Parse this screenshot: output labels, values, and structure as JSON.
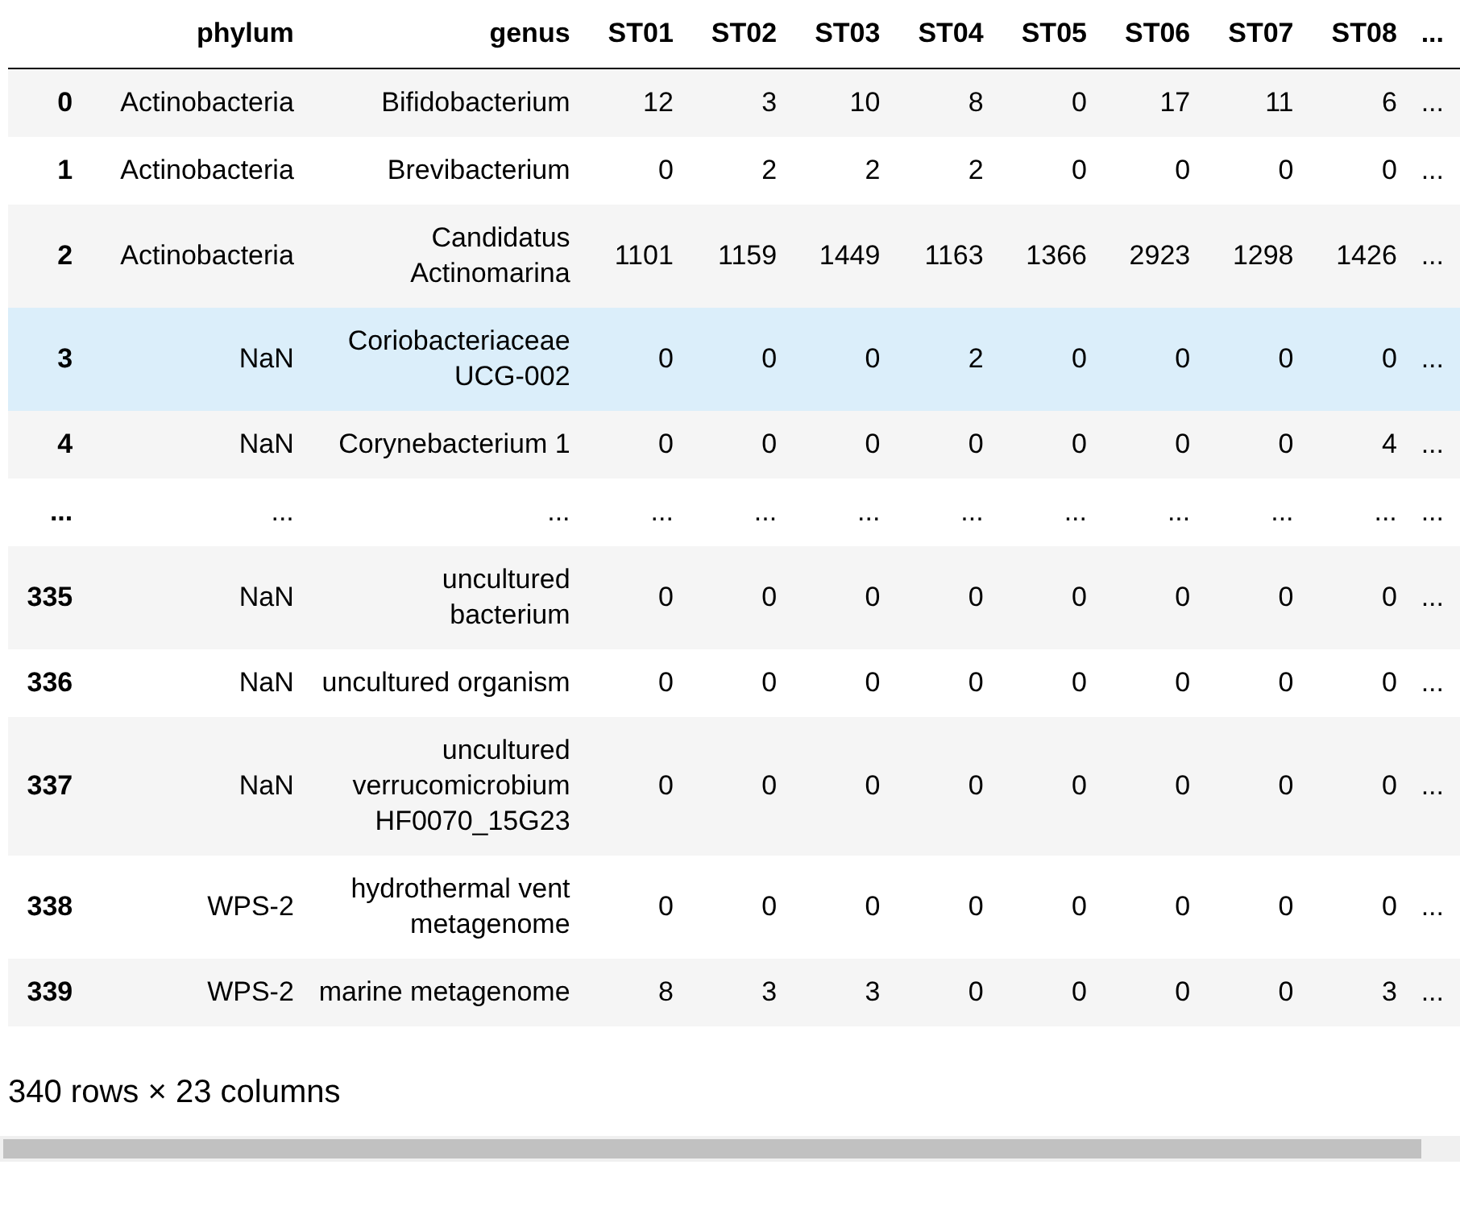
{
  "table": {
    "columns": [
      "phylum",
      "genus",
      "ST01",
      "ST02",
      "ST03",
      "ST04",
      "ST05",
      "ST06",
      "ST07",
      "ST08",
      "..."
    ],
    "rows": [
      {
        "index": "0",
        "highlighted": false,
        "cells": [
          "Actinobacteria",
          "Bifidobacterium",
          "12",
          "3",
          "10",
          "8",
          "0",
          "17",
          "11",
          "6",
          "..."
        ]
      },
      {
        "index": "1",
        "highlighted": false,
        "cells": [
          "Actinobacteria",
          "Brevibacterium",
          "0",
          "2",
          "2",
          "2",
          "0",
          "0",
          "0",
          "0",
          "..."
        ]
      },
      {
        "index": "2",
        "highlighted": false,
        "cells": [
          "Actinobacteria",
          "Candidatus Actinomarina",
          "1101",
          "1159",
          "1449",
          "1163",
          "1366",
          "2923",
          "1298",
          "1426",
          "..."
        ]
      },
      {
        "index": "3",
        "highlighted": true,
        "cells": [
          "NaN",
          "Coriobacteriaceae UCG-002",
          "0",
          "0",
          "0",
          "2",
          "0",
          "0",
          "0",
          "0",
          "..."
        ]
      },
      {
        "index": "4",
        "highlighted": false,
        "cells": [
          "NaN",
          "Corynebacterium 1",
          "0",
          "0",
          "0",
          "0",
          "0",
          "0",
          "0",
          "4",
          "..."
        ]
      },
      {
        "index": "...",
        "highlighted": false,
        "cells": [
          "...",
          "...",
          "...",
          "...",
          "...",
          "...",
          "...",
          "...",
          "...",
          "...",
          "..."
        ]
      },
      {
        "index": "335",
        "highlighted": false,
        "cells": [
          "NaN",
          "uncultured bacterium",
          "0",
          "0",
          "0",
          "0",
          "0",
          "0",
          "0",
          "0",
          "..."
        ]
      },
      {
        "index": "336",
        "highlighted": false,
        "cells": [
          "NaN",
          "uncultured organism",
          "0",
          "0",
          "0",
          "0",
          "0",
          "0",
          "0",
          "0",
          "..."
        ]
      },
      {
        "index": "337",
        "highlighted": false,
        "cells": [
          "NaN",
          "uncultured verrucomicrobium HF0070_15G23",
          "0",
          "0",
          "0",
          "0",
          "0",
          "0",
          "0",
          "0",
          "..."
        ]
      },
      {
        "index": "338",
        "highlighted": false,
        "cells": [
          "WPS-2",
          "hydrothermal vent metagenome",
          "0",
          "0",
          "0",
          "0",
          "0",
          "0",
          "0",
          "0",
          "..."
        ]
      },
      {
        "index": "339",
        "highlighted": false,
        "cells": [
          "WPS-2",
          "marine metagenome",
          "8",
          "3",
          "3",
          "0",
          "0",
          "0",
          "0",
          "3",
          "..."
        ]
      }
    ]
  },
  "caption": "340 rows × 23 columns"
}
